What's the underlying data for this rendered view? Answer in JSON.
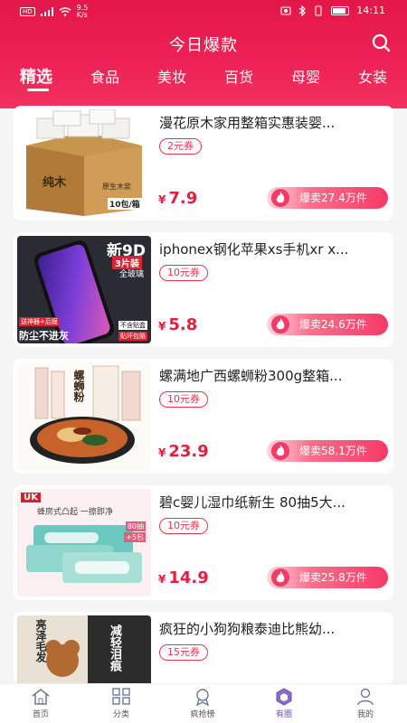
{
  "status": {
    "speed_value": "9.5",
    "speed_unit": "K/s",
    "time": "14:11",
    "sim": "HD"
  },
  "header": {
    "title": "今日爆款"
  },
  "tabs": [
    "精选",
    "食品",
    "美妆",
    "百货",
    "母婴",
    "女装"
  ],
  "products": [
    {
      "title": "漫花原木家用整箱实惠装婴...",
      "coupon": "2元券",
      "price": "7.9",
      "hot": "爆卖27.4万件",
      "thumb_text": [
        "纯木",
        "原生木浆",
        "10包/箱"
      ]
    },
    {
      "title": "iphonex钢化苹果xs手机xr x...",
      "coupon": "10元券",
      "price": "5.8",
      "hot": "爆卖24.6万件",
      "thumb_text": [
        "新9D",
        "3片装",
        "全玻璃",
        "防尘不进灰",
        "不含贴盒",
        "贴坏包赔",
        "送神器+后膜"
      ]
    },
    {
      "title": "螺满地广西螺蛳粉300g整箱...",
      "coupon": "10元券",
      "price": "23.9",
      "hot": "爆卖58.1万件",
      "thumb_text": [
        "螺蛳粉"
      ]
    },
    {
      "title": "碧c婴儿湿巾纸新生 80抽5大...",
      "coupon": "10元券",
      "price": "14.9",
      "hot": "爆卖25.8万件",
      "thumb_text": [
        "UK",
        "蜂房式凸起 一擦即净",
        "80抽",
        "+5包"
      ]
    },
    {
      "title": "疯狂的小狗狗粮泰迪比熊幼...",
      "coupon": "15元券",
      "price": "",
      "hot": "",
      "thumb_text": [
        "亮泽毛发",
        "减轻泪痕"
      ]
    }
  ],
  "price_prefix": "¥",
  "tabbar": [
    "首页",
    "分类",
    "疯抢榜",
    "有圈",
    "我的"
  ],
  "colors": {
    "brand": "#e8174b",
    "price": "#e0203e",
    "tab_active": "#6e4bb5"
  }
}
